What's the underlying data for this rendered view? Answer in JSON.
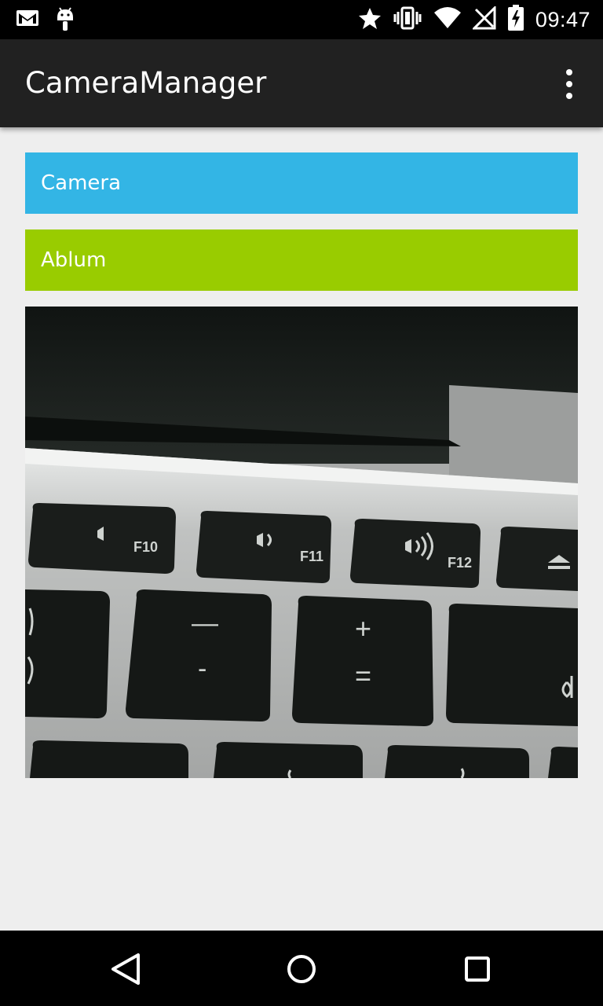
{
  "status_bar": {
    "time": "09:47",
    "icons": [
      "gmail-icon",
      "android-debug-icon",
      "star-icon",
      "vibrate-icon",
      "wifi-icon",
      "no-signal-icon",
      "battery-charging-icon"
    ]
  },
  "action_bar": {
    "title": "CameraManager",
    "overflow_icon": "overflow-menu-icon"
  },
  "buttons": {
    "camera_label": "Camera",
    "album_label": "Ablum"
  },
  "colors": {
    "camera_button": "#33b5e5",
    "album_button": "#99cc00",
    "action_bar": "#212121",
    "background": "#eeeeee"
  },
  "photo": {
    "key_labels": {
      "f10": "F10",
      "f11": "F11",
      "f12": "F12",
      "minus_top": "—",
      "minus_bottom": "-",
      "plus_top": "+",
      "plus_bottom": "="
    }
  },
  "nav_bar": {
    "icons": [
      "back-icon",
      "home-icon",
      "recents-icon"
    ]
  }
}
